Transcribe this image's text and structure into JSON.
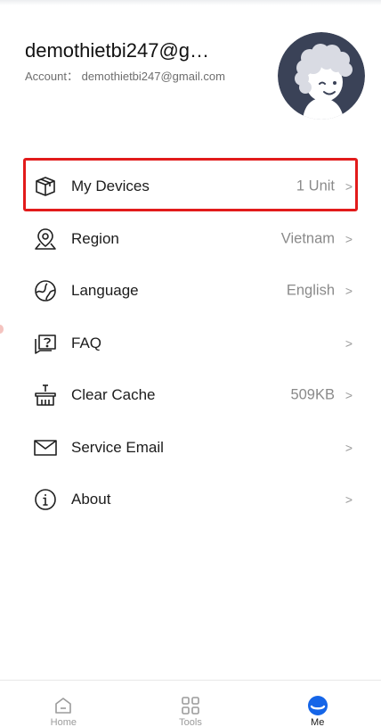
{
  "profile": {
    "name": "demothietbi247@g…",
    "account": "Account： demothietbi247@gmail.com",
    "avatar_icon": "user-avatar-cartoon"
  },
  "menu": {
    "items": [
      {
        "icon": "package-icon",
        "label": "My Devices",
        "value": "1 Unit",
        "chevron": ">"
      },
      {
        "icon": "location-pin-icon",
        "label": "Region",
        "value": "Vietnam",
        "chevron": ">"
      },
      {
        "icon": "globe-icon",
        "label": "Language",
        "value": "English",
        "chevron": ">"
      },
      {
        "icon": "faq-icon",
        "label": "FAQ",
        "value": "",
        "chevron": ">"
      },
      {
        "icon": "broom-basket-icon",
        "label": "Clear Cache",
        "value": "509KB",
        "chevron": ">"
      },
      {
        "icon": "mail-icon",
        "label": "Service Email",
        "value": "",
        "chevron": ">"
      },
      {
        "icon": "info-icon",
        "label": "About",
        "value": "",
        "chevron": ">"
      }
    ]
  },
  "bottom_nav": {
    "tabs": [
      {
        "icon": "home-icon",
        "label": "Home",
        "active": false
      },
      {
        "icon": "tools-grid-icon",
        "label": "Tools",
        "active": false
      },
      {
        "icon": "me-icon",
        "label": "Me",
        "active": true
      }
    ]
  },
  "colors": {
    "highlight_border": "#e21b1b",
    "active_tab": "#1565e8",
    "avatar_bg": "#3a4257"
  }
}
